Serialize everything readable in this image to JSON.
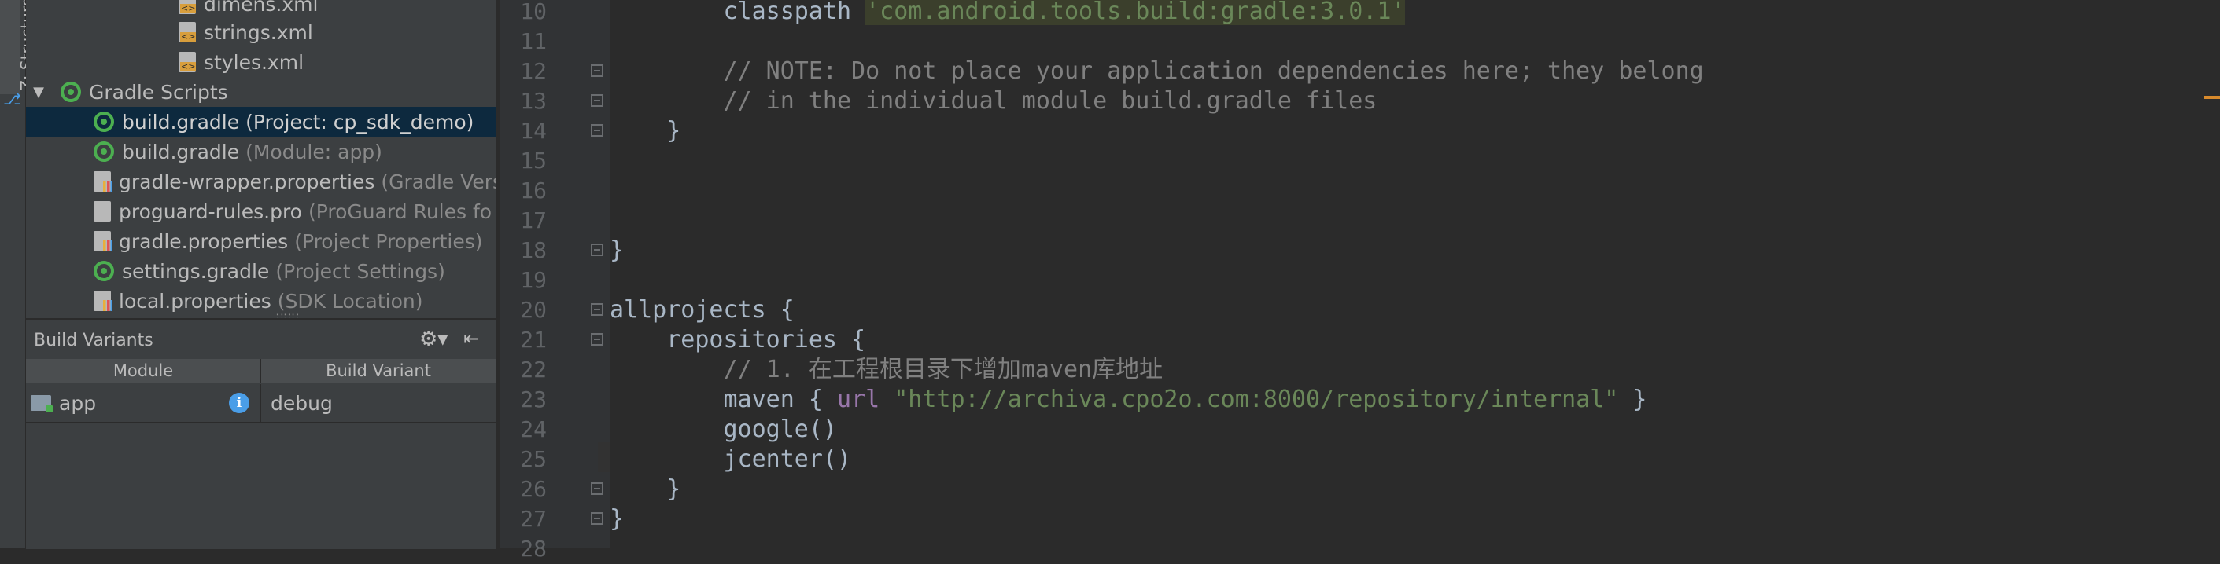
{
  "sidebar_tool": {
    "structure_label": "Z: Structure"
  },
  "project_tree": {
    "items": [
      {
        "label": "dimens.xml",
        "hint": ""
      },
      {
        "label": "strings.xml",
        "hint": ""
      },
      {
        "label": "styles.xml",
        "hint": ""
      },
      {
        "label": "Gradle Scripts",
        "hint": ""
      },
      {
        "label": "build.gradle",
        "hint": "(Project: cp_sdk_demo)"
      },
      {
        "label": "build.gradle",
        "hint": "(Module: app)"
      },
      {
        "label": "gradle-wrapper.properties",
        "hint": "(Gradle Vers"
      },
      {
        "label": "proguard-rules.pro",
        "hint": "(ProGuard Rules fo"
      },
      {
        "label": "gradle.properties",
        "hint": "(Project Properties)"
      },
      {
        "label": "settings.gradle",
        "hint": "(Project Settings)"
      },
      {
        "label": "local.properties",
        "hint": "(SDK Location)"
      }
    ],
    "grip": "∷∷∷"
  },
  "build_variants": {
    "title": "Build Variants",
    "col_module": "Module",
    "col_variant": "Build Variant",
    "row_module": "app",
    "row_variant": "debug",
    "info_glyph": "i"
  },
  "editor": {
    "line_numbers": [
      "10",
      "11",
      "12",
      "13",
      "14",
      "15",
      "16",
      "17",
      "18",
      "19",
      "20",
      "21",
      "22",
      "23",
      "24",
      "25",
      "26",
      "27",
      "28"
    ],
    "lines": {
      "l10_prefix": "        classpath ",
      "l10_str": "'com.android.tools.build:gradle:3.0.1'",
      "l12": "        // NOTE: Do not place your application dependencies here; they belong",
      "l13": "        // in the individual module build.gradle files",
      "l14": "    }",
      "l18": "}",
      "l20": "allprojects {",
      "l21": "    repositories {",
      "l22": "        // 1. 在工程根目录下增加maven库地址",
      "l23_a": "        maven { ",
      "l23_kw": "url",
      "l23_sp": " ",
      "l23_str": "\"http://archiva.cpo2o.com:8000/repository/internal\"",
      "l23_end": " }",
      "l24": "        google()",
      "l25": "        jcenter()",
      "l26": "    }",
      "l27": "}"
    }
  },
  "colors": {
    "background": "#2b2b2b",
    "panel": "#3c3f41",
    "selection": "#0d293e",
    "string": "#6a8759",
    "comment": "#808080",
    "property": "#9876aa"
  }
}
